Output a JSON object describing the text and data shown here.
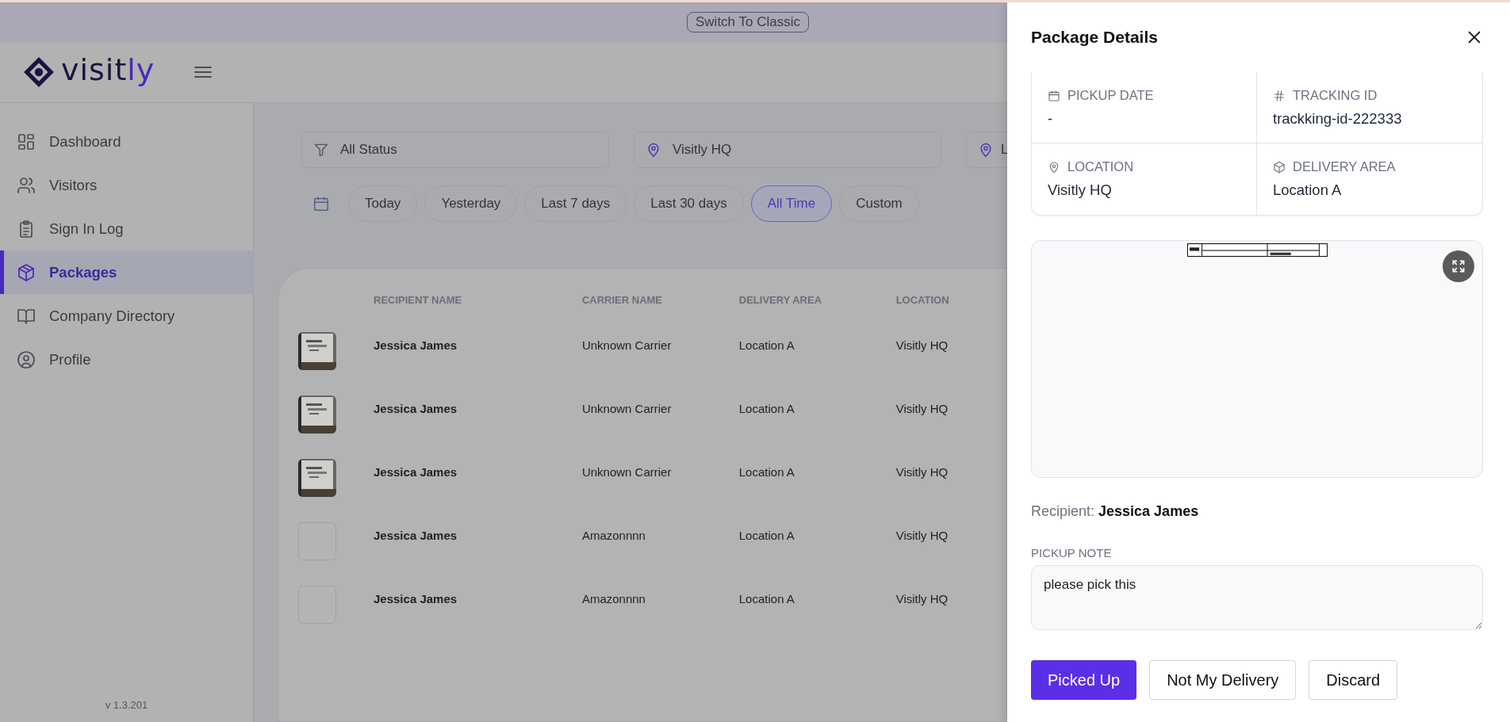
{
  "topbar": {
    "switch_button": "Switch To Classic"
  },
  "logo": {
    "main": "visit",
    "accent": "ly"
  },
  "sidebar": {
    "items": [
      {
        "label": "Dashboard",
        "selected": false
      },
      {
        "label": "Visitors",
        "selected": false
      },
      {
        "label": "Sign In Log",
        "selected": false
      },
      {
        "label": "Packages",
        "selected": true
      },
      {
        "label": "Company Directory",
        "selected": false
      },
      {
        "label": "Profile",
        "selected": false
      }
    ],
    "version": "v 1.3.201"
  },
  "filters": [
    {
      "kind": "status",
      "value": "All Status"
    },
    {
      "kind": "location",
      "value": "Visitly HQ"
    },
    {
      "kind": "location",
      "value": "L"
    }
  ],
  "date_ranges": [
    {
      "label": "Today",
      "selected": false
    },
    {
      "label": "Yesterday",
      "selected": false
    },
    {
      "label": "Last 7 days",
      "selected": false
    },
    {
      "label": "Last 30 days",
      "selected": false
    },
    {
      "label": "All Time",
      "selected": true
    },
    {
      "label": "Custom",
      "selected": false
    }
  ],
  "table": {
    "columns": [
      "RECIPIENT NAME",
      "CARRIER NAME",
      "DELIVERY AREA",
      "LOCATION"
    ],
    "rows": [
      {
        "has_photo": true,
        "recipient": "Jessica James",
        "carrier": "Unknown Carrier",
        "delivery_area": "Location A",
        "location": "Visitly HQ"
      },
      {
        "has_photo": true,
        "recipient": "Jessica James",
        "carrier": "Unknown Carrier",
        "delivery_area": "Location A",
        "location": "Visitly HQ"
      },
      {
        "has_photo": true,
        "recipient": "Jessica James",
        "carrier": "Unknown Carrier",
        "delivery_area": "Location A",
        "location": "Visitly HQ"
      },
      {
        "has_photo": false,
        "recipient": "Jessica James",
        "carrier": "Amazonnnn",
        "delivery_area": "Location A",
        "location": "Visitly HQ"
      },
      {
        "has_photo": false,
        "recipient": "Jessica James",
        "carrier": "Amazonnnn",
        "delivery_area": "Location A",
        "location": "Visitly HQ"
      }
    ]
  },
  "drawer": {
    "title": "Package Details",
    "details": [
      {
        "label": "PICKUP DATE",
        "value": "-"
      },
      {
        "label": "TRACKING ID",
        "value": "trackking-id-222333"
      },
      {
        "label": "LOCATION",
        "value": "Visitly HQ"
      },
      {
        "label": "DELIVERY AREA",
        "value": "Location A"
      }
    ],
    "recipient": "Recipient: **Jessica James**",
    "note_label": "PICKUP NOTE",
    "note": "please pick this",
    "buttons": [
      {
        "label": "Picked Up",
        "kind": "primary"
      },
      {
        "label": "Not My Delivery",
        "kind": "secondary"
      },
      {
        "label": "Discard",
        "kind": "secondary"
      }
    ]
  }
}
